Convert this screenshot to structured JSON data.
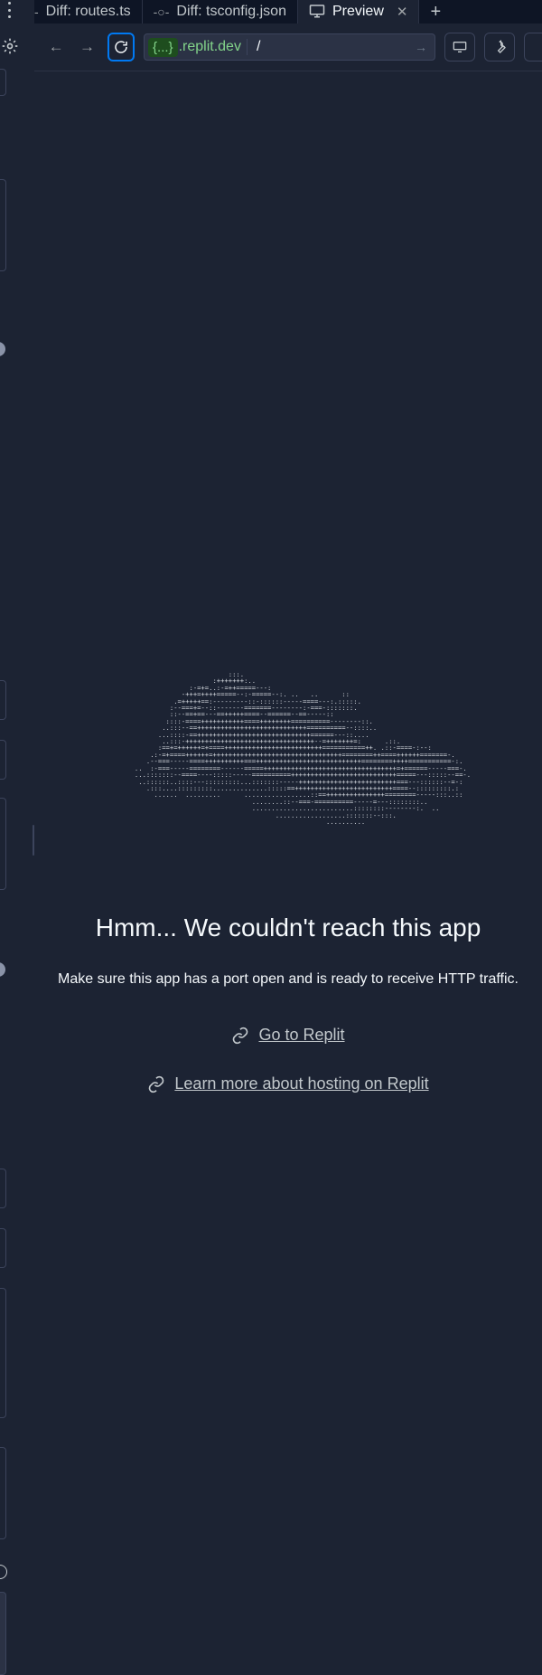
{
  "tabs": [
    {
      "label": "Diff: routes.ts",
      "icon": "commit-icon"
    },
    {
      "label": "Diff: tsconfig.json",
      "icon": "commit-icon"
    },
    {
      "label": "Preview",
      "icon": "monitor-icon",
      "active": true
    }
  ],
  "address": {
    "pill": "{...}",
    "domain": ".replit.dev",
    "path": "/"
  },
  "error": {
    "ascii_art": "                        :::.\n                    :+++++++:..\n              :-=+=..:-=++=====---:\n            -+++=++++=====--:-=====--:. ..   ..      ::\n          .=+++++==:---------::-::::::-----====---:.:::::.\n         :--===+=--::-------=======--------:-===-:::::::.\n         ::--==+==---==+++++====--======--==-----::\n        ::::-====+++++++++++====++++++++==========--------::.\n       ..:::--==++++++++++++++++++++++++++++==========--::::..\n      ...::::-==+++++++++++++++++++++++++++++======---::....\n       ..:::-+++++++++++++++++++++++++++++++++--=+++++++=:      .::.\n      :==+=++++++=+====+++++++++++++++++++++++++===========++. .::-====-:--:\n    .:-=+====++++++=+++++++++++++++++++++++++++++++++========++====++++++=======-.\n   .--===-----====++++++++++===+++++++++++++++++++++++++++========++++===========-:.\n..  :-===-----========------=====++++++++++++++++++++++++++++++++++=+======-----===-.\n...:::::::--====----:::::-----==========+++++++++++++++++++++++++++=====---:::::--==-.\n ..::::::..::::---:::::::::...:::::::-----+++++++++++++++++++++++++===---::::::--=-:\n   .:::....:::::::::..............:::::==+++++++++++++++++++++++++====--:::::::::.:\n     ......  .........      .................::==+++++++++++++++========-----:::..::\n                              ........::--===-==========-----=---::::::::..\n                              ..........................::::::::--------:.  ..\n                                    ..................:::::::--:::.\n                                                 ..........",
    "headline": "Hmm... We couldn't reach this app",
    "message": "Make sure this app has a port open and is ready to receive HTTP traffic.",
    "link1": "Go to Replit",
    "link2": "Learn more about hosting on Replit"
  }
}
